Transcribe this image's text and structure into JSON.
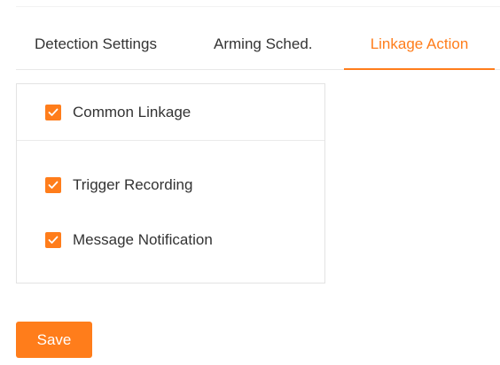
{
  "tabs": [
    {
      "label": "Detection Settings",
      "active": false
    },
    {
      "label": "Arming Sched.",
      "active": false
    },
    {
      "label": "Linkage Action",
      "active": true
    }
  ],
  "panel": {
    "common_linkage": {
      "label": "Common Linkage",
      "checked": true
    },
    "options": [
      {
        "label": "Trigger Recording",
        "checked": true
      },
      {
        "label": "Message Notification",
        "checked": true
      }
    ]
  },
  "save_label": "Save",
  "colors": {
    "accent": "#ff7d1b",
    "text": "#333333",
    "border": "#e3e3e3"
  }
}
